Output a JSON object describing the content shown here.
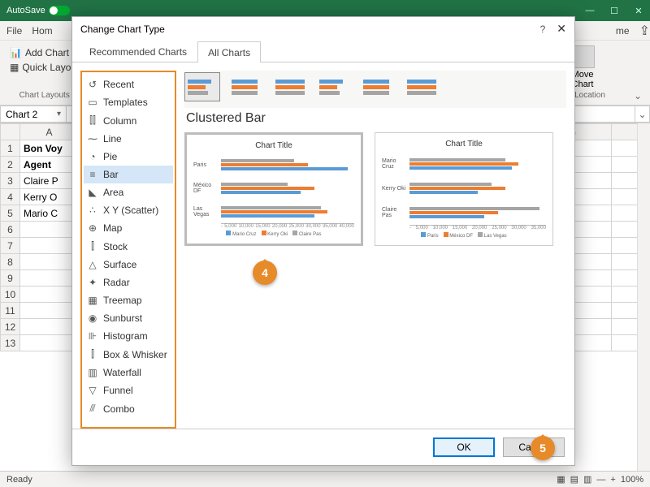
{
  "app": {
    "autosave_label": "AutoSave",
    "tab_file": "File",
    "tab_home": "Hom",
    "min": "—",
    "max": "☐",
    "close": "✕"
  },
  "ribbon": {
    "add_chart": "Add Chart",
    "quick_layout": "Quick Layout",
    "layouts_label": "Chart Layouts",
    "move_chart": "Move\nChart",
    "location_label": "Location",
    "me": "me"
  },
  "name_box": "Chart 2",
  "sheet": {
    "colA": "A",
    "colG": "G",
    "a1": "Bon Voy",
    "a2": "Agent",
    "a3": "Claire P",
    "a4": "Kerry O",
    "a5": "Mario C"
  },
  "dialog": {
    "title": "Change Chart Type",
    "help": "?",
    "close": "✕",
    "tab_rec": "Recommended Charts",
    "tab_all": "All Charts",
    "categories": [
      {
        "icon": "↺",
        "label": "Recent"
      },
      {
        "icon": "▭",
        "label": "Templates"
      },
      {
        "icon": "⫿⫿",
        "label": "Column"
      },
      {
        "icon": "⁓",
        "label": "Line"
      },
      {
        "icon": "◔",
        "label": "Pie"
      },
      {
        "icon": "≡",
        "label": "Bar"
      },
      {
        "icon": "◣",
        "label": "Area"
      },
      {
        "icon": "∴",
        "label": "X Y (Scatter)"
      },
      {
        "icon": "⊕",
        "label": "Map"
      },
      {
        "icon": "⫿",
        "label": "Stock"
      },
      {
        "icon": "△",
        "label": "Surface"
      },
      {
        "icon": "✦",
        "label": "Radar"
      },
      {
        "icon": "▦",
        "label": "Treemap"
      },
      {
        "icon": "◉",
        "label": "Sunburst"
      },
      {
        "icon": "⊪",
        "label": "Histogram"
      },
      {
        "icon": "⫿",
        "label": "Box & Whisker"
      },
      {
        "icon": "▥",
        "label": "Waterfall"
      },
      {
        "icon": "▽",
        "label": "Funnel"
      },
      {
        "icon": "⫻",
        "label": "Combo"
      }
    ],
    "selected_category": 5,
    "subtype_label": "Clustered Bar",
    "preview1": {
      "title": "Chart Title",
      "rows": [
        "Paris",
        "México DF",
        "Las Vegas"
      ],
      "axis": [
        "-",
        "5,000",
        "10,000",
        "15,000",
        "20,000",
        "25,000",
        "30,000",
        "35,000",
        "40,000"
      ],
      "legend": [
        "Mario Cruz",
        "Kerry Oki",
        "Claire Pas"
      ]
    },
    "preview2": {
      "title": "Chart Title",
      "rows": [
        "Mario Cruz",
        "Kerry Oki",
        "Claire Pas"
      ],
      "axis": [
        "-",
        "5,000",
        "10,000",
        "15,000",
        "20,000",
        "25,000",
        "30,000",
        "35,000"
      ],
      "legend": [
        "Paris",
        "México DF",
        "Las Vegas"
      ]
    },
    "ok": "OK",
    "cancel": "Cancel"
  },
  "status": {
    "ready": "Ready",
    "zoom": "100%",
    "plus": "+"
  }
}
